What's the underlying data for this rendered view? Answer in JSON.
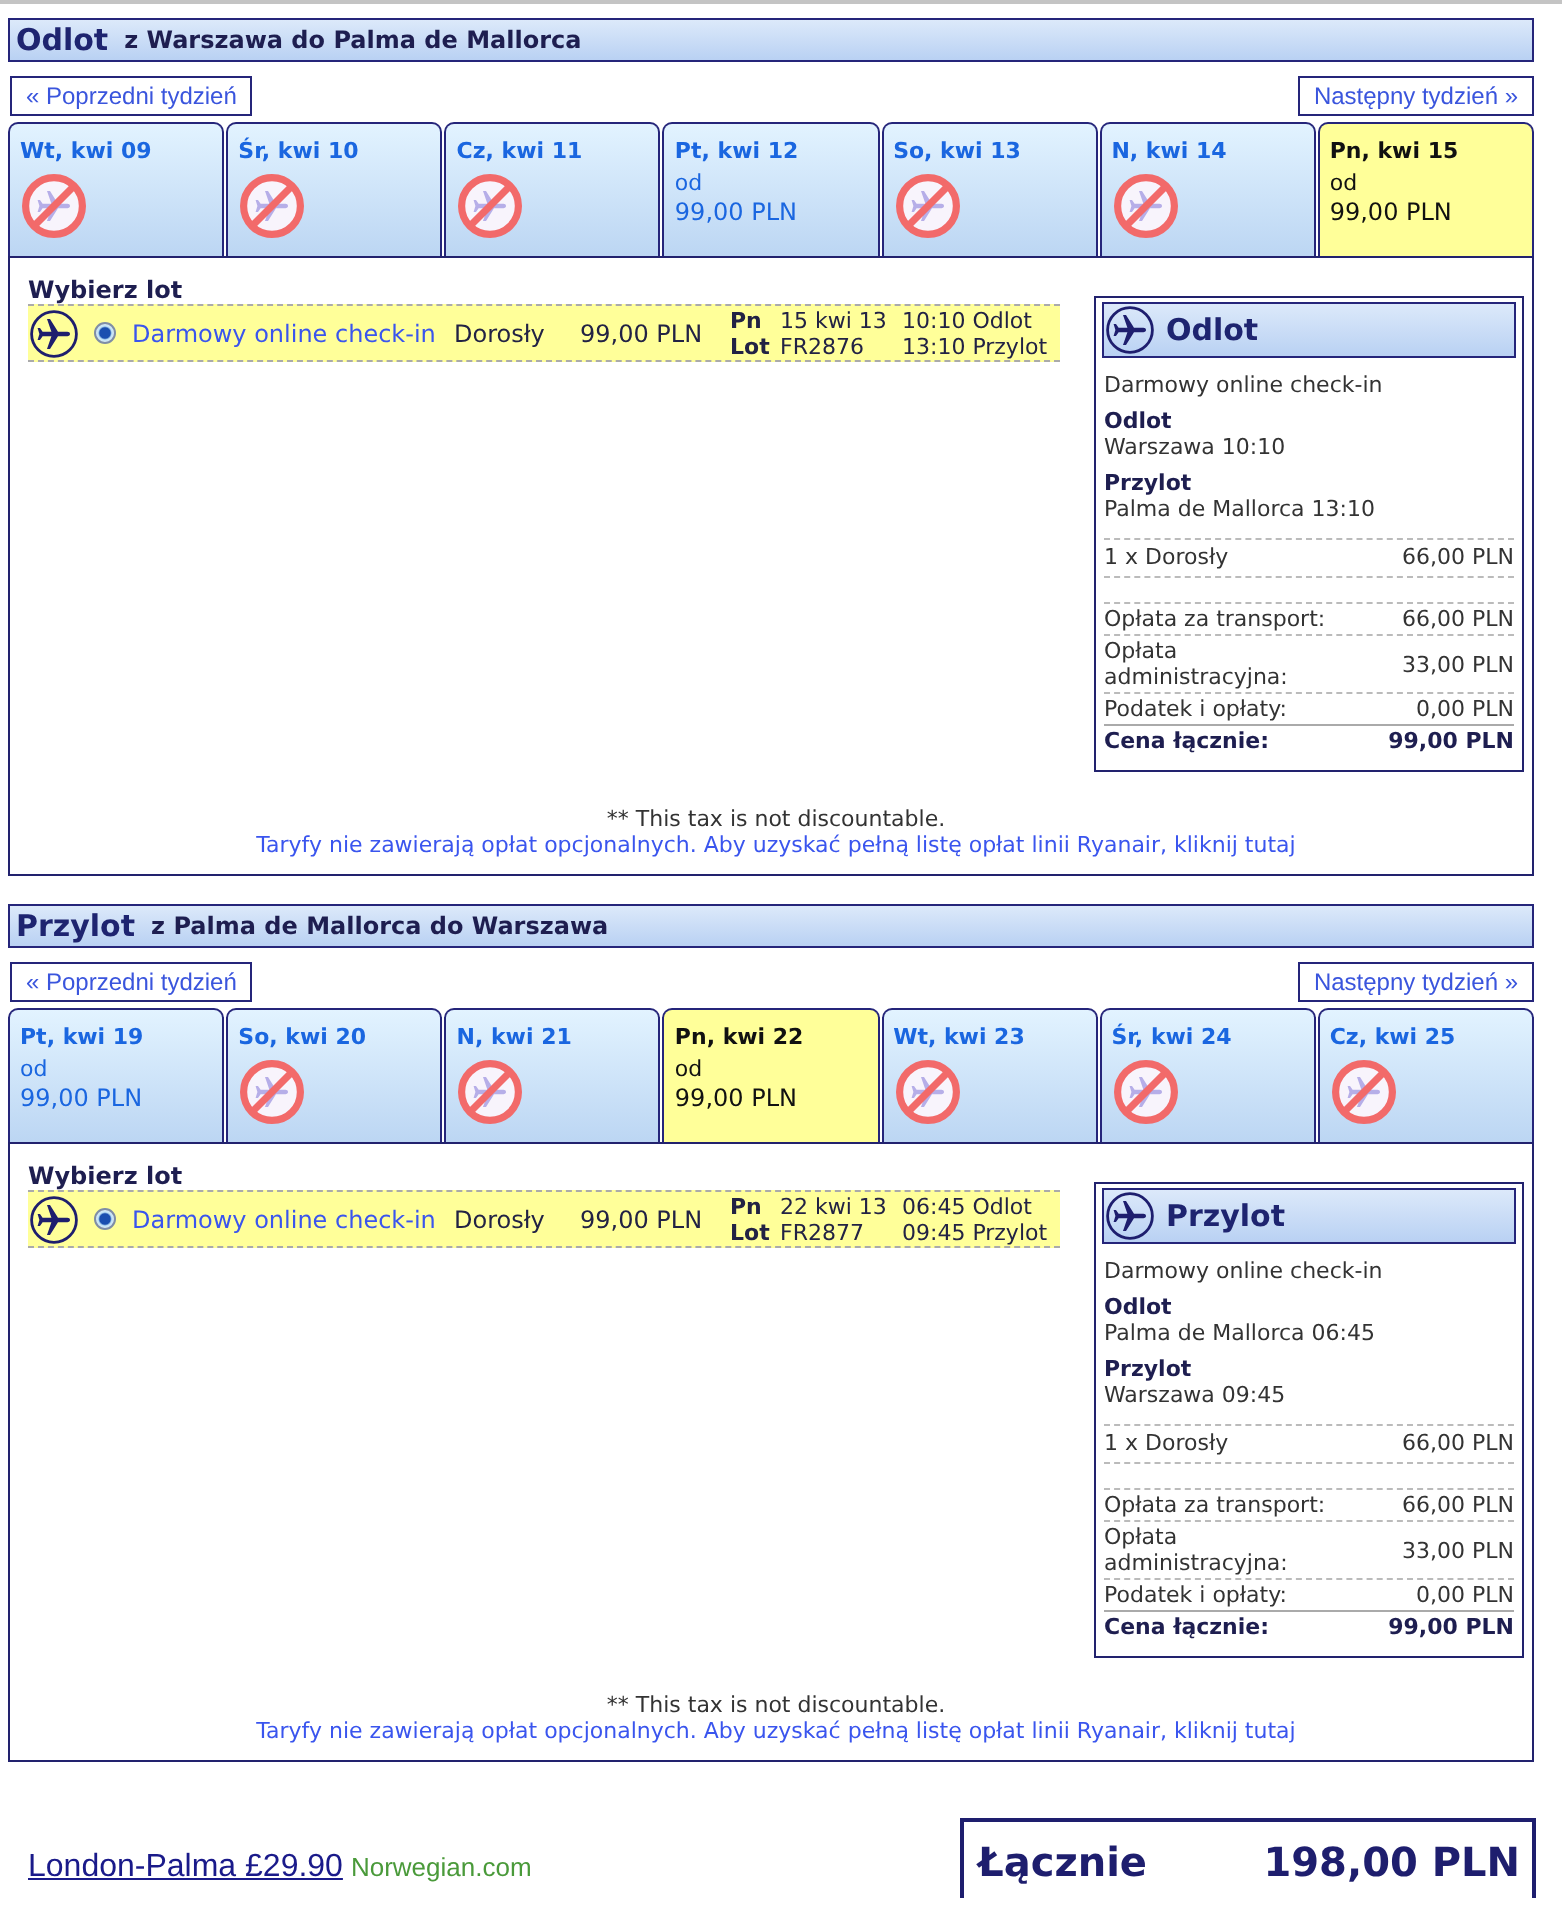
{
  "sections": [
    {
      "title": "Odlot",
      "route": "z Warszawa do Palma de Mallorca",
      "prev_week": "« Poprzedni tydzień",
      "next_week": "Następny tydzień »",
      "days": [
        {
          "label": "Wt, kwi 09",
          "selected": false,
          "available": false
        },
        {
          "label": "Śr, kwi 10",
          "selected": false,
          "available": false
        },
        {
          "label": "Cz, kwi 11",
          "selected": false,
          "available": false
        },
        {
          "label": "Pt, kwi 12",
          "selected": false,
          "available": true,
          "from": "od",
          "price": "99,00 PLN"
        },
        {
          "label": "So, kwi 13",
          "selected": false,
          "available": false
        },
        {
          "label": "N, kwi 14",
          "selected": false,
          "available": false
        },
        {
          "label": "Pn, kwi 15",
          "selected": true,
          "available": true,
          "from": "od",
          "price": "99,00 PLN"
        }
      ],
      "choose_label": "Wybierz lot",
      "flights": [
        {
          "selected": true,
          "fare": "Darmowy online check-in",
          "passenger": "Dorosły",
          "price": "99,00 PLN",
          "day": "Pn",
          "date": "15 kwi 13",
          "departure": "10:10 Odlot",
          "flight_label": "Lot",
          "flight_no": "FR2876",
          "arrival": "13:10 Przylot"
        }
      ],
      "summary": {
        "title": "Odlot",
        "fare": "Darmowy online check-in",
        "legs": [
          {
            "label": "Odlot",
            "value": "Warszawa 10:10"
          },
          {
            "label": "Przylot",
            "value": "Palma de Mallorca 13:10"
          }
        ],
        "passengers": [
          {
            "label": "1 x Dorosły",
            "amount": "66,00 PLN"
          }
        ],
        "charges": [
          {
            "label": "Opłata za transport:",
            "amount": "66,00 PLN"
          },
          {
            "label": "Opłata administracyjna:",
            "amount": "33,00 PLN"
          },
          {
            "label": "Podatek i opłaty:",
            "amount": "0,00 PLN"
          }
        ],
        "total": {
          "label": "Cena łącznie:",
          "amount": "99,00 PLN"
        }
      },
      "tax_note": "** This tax is not discountable.",
      "fees_link": "Taryfy nie zawierają opłat opcjonalnych. Aby uzyskać pełną listę opłat linii Ryanair, kliknij tutaj"
    },
    {
      "title": "Przylot",
      "route": "z Palma de Mallorca do Warszawa",
      "prev_week": "« Poprzedni tydzień",
      "next_week": "Następny tydzień »",
      "days": [
        {
          "label": "Pt, kwi 19",
          "selected": false,
          "available": true,
          "from": "od",
          "price": "99,00 PLN"
        },
        {
          "label": "So, kwi 20",
          "selected": false,
          "available": false
        },
        {
          "label": "N, kwi 21",
          "selected": false,
          "available": false
        },
        {
          "label": "Pn, kwi 22",
          "selected": true,
          "available": true,
          "from": "od",
          "price": "99,00 PLN"
        },
        {
          "label": "Wt, kwi 23",
          "selected": false,
          "available": false
        },
        {
          "label": "Śr, kwi 24",
          "selected": false,
          "available": false
        },
        {
          "label": "Cz, kwi 25",
          "selected": false,
          "available": false
        }
      ],
      "choose_label": "Wybierz lot",
      "flights": [
        {
          "selected": true,
          "fare": "Darmowy online check-in",
          "passenger": "Dorosły",
          "price": "99,00 PLN",
          "day": "Pn",
          "date": "22 kwi 13",
          "departure": "06:45 Odlot",
          "flight_label": "Lot",
          "flight_no": "FR2877",
          "arrival": "09:45 Przylot"
        }
      ],
      "summary": {
        "title": "Przylot",
        "fare": "Darmowy online check-in",
        "legs": [
          {
            "label": "Odlot",
            "value": "Palma de Mallorca 06:45"
          },
          {
            "label": "Przylot",
            "value": "Warszawa 09:45"
          }
        ],
        "passengers": [
          {
            "label": "1 x Dorosły",
            "amount": "66,00 PLN"
          }
        ],
        "charges": [
          {
            "label": "Opłata za transport:",
            "amount": "66,00 PLN"
          },
          {
            "label": "Opłata administracyjna:",
            "amount": "33,00 PLN"
          },
          {
            "label": "Podatek i opłaty:",
            "amount": "0,00 PLN"
          }
        ],
        "total": {
          "label": "Cena łącznie:",
          "amount": "99,00 PLN"
        }
      },
      "tax_note": "** This tax is not discountable.",
      "fees_link": "Taryfy nie zawierają opłat opcjonalnych. Aby uzyskać pełną listę opłat linii Ryanair, kliknij tutaj"
    }
  ],
  "ad": {
    "title": "London-Palma £29.90",
    "domain": "Norwegian.com"
  },
  "total": {
    "label": "Łącznie",
    "amount": "198,00 PLN"
  }
}
